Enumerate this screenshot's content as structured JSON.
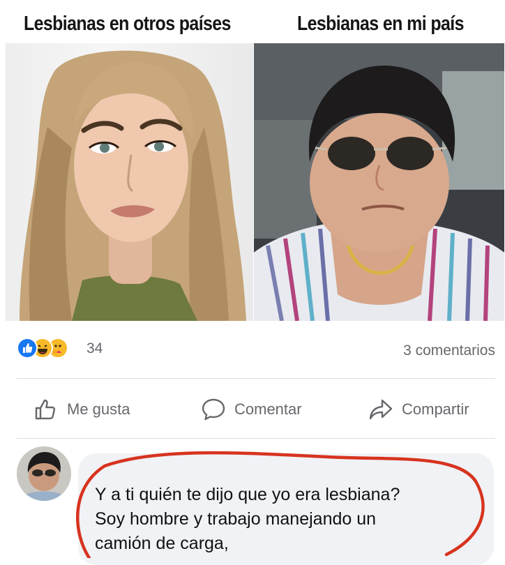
{
  "meme": {
    "caption_left": "Lesbianas en otros países",
    "caption_right": "Lesbianas en mi país"
  },
  "post": {
    "reactions": [
      "like-icon",
      "haha-icon",
      "care-icon"
    ],
    "reaction_count": "34",
    "comment_count": "3 comentarios"
  },
  "actions": {
    "like": "Me gusta",
    "comment": "Comentar",
    "share": "Compartir"
  },
  "comment": {
    "lines": [
      "Y a ti quién te dijo que yo era lesbiana?",
      "Soy hombre y trabajo manejando un",
      "camión de carga,"
    ],
    "highlight_color": "#d7331f"
  },
  "colors": {
    "facebook_blue": "#1877f2",
    "icon_gray": "#65676b",
    "bubble_bg": "#f0f2f5"
  }
}
